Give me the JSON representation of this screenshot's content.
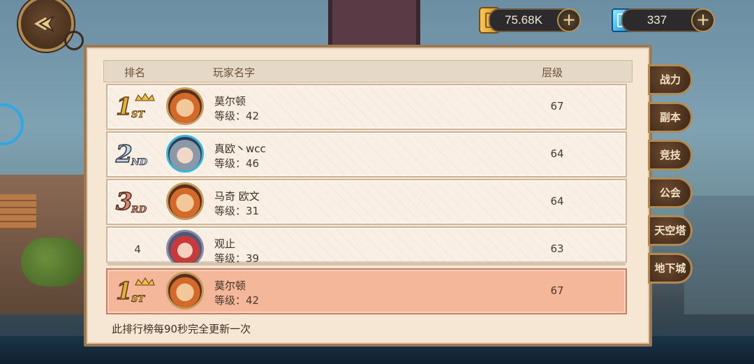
{
  "resources": {
    "gold": "75.68K",
    "gems": "337",
    "plus": "+"
  },
  "table": {
    "headers": {
      "rank": "排名",
      "name": "玩家名字",
      "level": "层级"
    },
    "rows": [
      {
        "rank": "1",
        "rank_label": "1",
        "rank_suffix": "ST",
        "name": "莫尔顿",
        "level_text": "等级：42",
        "floor": "67"
      },
      {
        "rank": "2",
        "rank_label": "2",
        "rank_suffix": "ND",
        "name": "真欧丶wcc",
        "level_text": "等级：46",
        "floor": "64"
      },
      {
        "rank": "3",
        "rank_label": "3",
        "rank_suffix": "RD",
        "name": "马奇 欧文",
        "level_text": "等级：31",
        "floor": "64"
      },
      {
        "rank": "4",
        "rank_label": "4",
        "name": "观止",
        "level_text": "等级：39",
        "floor": "63"
      }
    ],
    "my_row": {
      "rank_label": "1",
      "rank_suffix": "ST",
      "name": "莫尔顿",
      "level_text": "等级：42",
      "floor": "67"
    },
    "footer": "此排行榜每90秒完全更新一次"
  },
  "side_tabs": [
    "战力",
    "副本",
    "竞技",
    "公会",
    "天空塔",
    "地下城"
  ],
  "colors": {
    "panel": "#f5e7d3",
    "my_row": "#f5b79a",
    "gold": "#e2b03a",
    "silver": "#a9b9cc",
    "bronze": "#c6745a",
    "accent_blue": "#2ea7e6"
  }
}
